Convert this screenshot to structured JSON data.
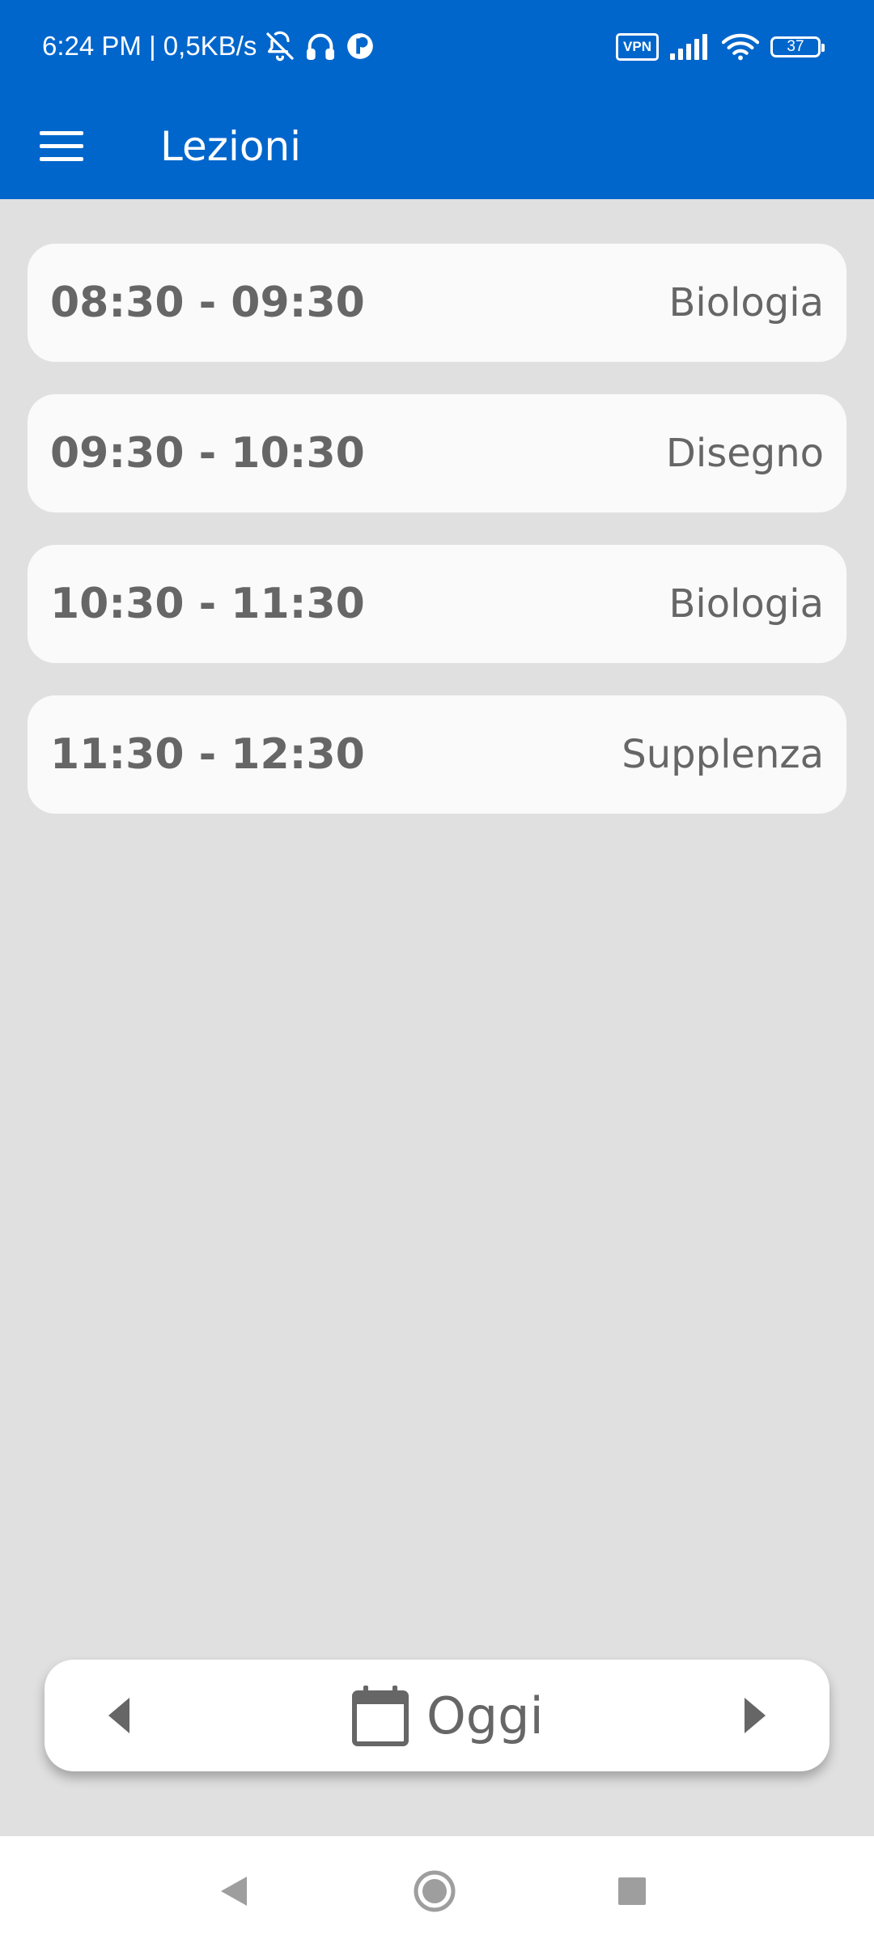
{
  "status_bar": {
    "time_text": "6:24 PM | 0,5KB/s",
    "left_icons": [
      "bell-off-icon",
      "headset-icon",
      "app-notification-icon"
    ],
    "vpn_label": "VPN",
    "right_icons": [
      "signal-icon",
      "wifi-icon"
    ],
    "battery_level": "37"
  },
  "app_bar": {
    "title": "Lezioni",
    "menu_icon": "menu-icon",
    "color": "#0066cc"
  },
  "lessons": [
    {
      "time": "08:30 - 09:30",
      "subject": "Biologia"
    },
    {
      "time": "09:30 - 10:30",
      "subject": "Disegno"
    },
    {
      "time": "10:30 - 11:30",
      "subject": "Biologia"
    },
    {
      "time": "11:30 - 12:30",
      "subject": "Supplenza"
    }
  ],
  "date_nav": {
    "prev_icon": "chevron-left-icon",
    "next_icon": "chevron-right-icon",
    "calendar_icon": "calendar-icon",
    "today_label": "Oggi"
  },
  "system_nav": {
    "icons": [
      "back-icon",
      "home-icon",
      "recents-icon"
    ]
  },
  "colors": {
    "background": "#e0e0e0",
    "card": "#fafafa",
    "text": "#666666"
  }
}
